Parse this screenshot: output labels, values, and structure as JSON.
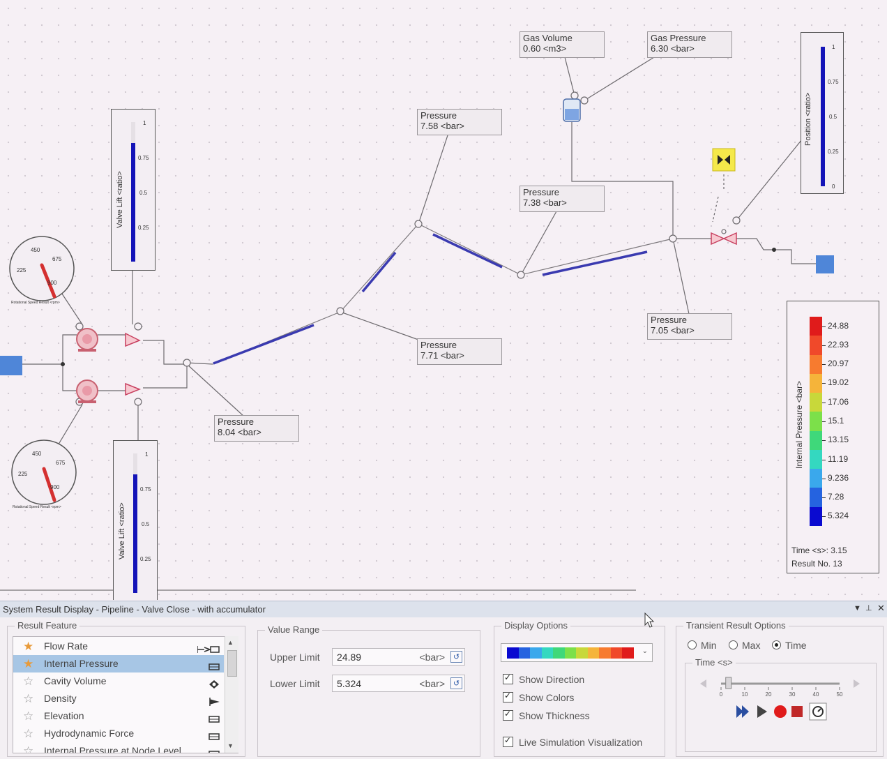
{
  "diagram": {
    "result_labels": [
      {
        "name": "Gas Volume",
        "value": "0.60 <m3>"
      },
      {
        "name": "Gas Pressure",
        "value": "6.30 <bar>"
      },
      {
        "name": "Pressure",
        "value": "7.58 <bar>"
      },
      {
        "name": "Pressure",
        "value": "7.38 <bar>"
      },
      {
        "name": "Pressure",
        "value": "7.71 <bar>"
      },
      {
        "name": "Pressure",
        "value": "7.05 <bar>"
      },
      {
        "name": "Pressure",
        "value": "8.04 <bar>"
      }
    ],
    "valve_gauges": [
      {
        "title": "Valve Lift <ratio>",
        "ticks": [
          "1",
          "0.75",
          "0.5",
          "0.25"
        ],
        "level": 0.85
      },
      {
        "title": "Valve Lift <ratio>",
        "ticks": [
          "1",
          "0.75",
          "0.5",
          "0.25"
        ],
        "level": 0.85
      }
    ],
    "position_gauge": {
      "title": "Position <ratio>",
      "ticks": [
        "1",
        "0.75",
        "0.5",
        "0.25",
        "0"
      ],
      "level": 1.0
    },
    "speed_dials": [
      {
        "ticks": [
          "450",
          "675",
          "225",
          "900"
        ],
        "caption": "Rotational Speed Result <rpm>"
      },
      {
        "ticks": [
          "450",
          "675",
          "225",
          "900"
        ],
        "caption": "Rotational Speed Result <rpm>"
      }
    ],
    "legend": {
      "title": "Internal Pressure <bar>",
      "values": [
        "24.88",
        "22.93",
        "20.97",
        "19.02",
        "17.06",
        "15.1",
        "13.15",
        "11.19",
        "9.236",
        "7.28",
        "5.324"
      ],
      "colors": [
        "#e01b1b",
        "#f0492a",
        "#f77b2f",
        "#f5b43a",
        "#c8d83a",
        "#7ce04a",
        "#3fd87a",
        "#34d8c0",
        "#3aa8ec",
        "#2563e0",
        "#0a0ad0"
      ],
      "time": "Time <s>: 3.15",
      "result_no": "Result No. 13"
    },
    "pipe_color": "#3a3ab0"
  },
  "panel": {
    "title": "System Result Display - Pipeline - Valve Close - with accumulator",
    "result_feature": {
      "label": "Result Feature",
      "items": [
        {
          "label": "Flow Rate",
          "icon": "flow-rate-icon",
          "favorite": true,
          "selected": false
        },
        {
          "label": "Internal Pressure",
          "icon": "pipe-icon",
          "favorite": true,
          "selected": true
        },
        {
          "label": "Cavity Volume",
          "icon": "node-diamond-icon",
          "favorite": false,
          "selected": false
        },
        {
          "label": "Density",
          "icon": "flag-icon",
          "favorite": false,
          "selected": false
        },
        {
          "label": "Elevation",
          "icon": "pipe-icon",
          "favorite": false,
          "selected": false
        },
        {
          "label": "Hydrodynamic Force",
          "icon": "pipe-icon",
          "favorite": false,
          "selected": false
        },
        {
          "label": "Internal Pressure at Node Level",
          "icon": "pipe-icon",
          "favorite": false,
          "selected": false
        }
      ]
    },
    "value_range": {
      "label": "Value Range",
      "upper_label": "Upper Limit",
      "upper_value": "24.89",
      "lower_label": "Lower Limit",
      "lower_value": "5.324",
      "unit": "<bar>"
    },
    "display_options": {
      "label": "Display Options",
      "checkboxes": [
        "Show Direction",
        "Show Colors",
        "Show Thickness"
      ],
      "live": "Live Simulation Visualization"
    },
    "transient": {
      "label": "Transient Result Options",
      "radios": [
        {
          "label": "Min",
          "selected": false
        },
        {
          "label": "Max",
          "selected": false
        },
        {
          "label": "Time",
          "selected": true
        }
      ],
      "time_label": "Time <s>",
      "slider_ticks": [
        "0",
        "10",
        "20",
        "30",
        "40",
        "50"
      ],
      "slider_value": 3.15
    }
  }
}
